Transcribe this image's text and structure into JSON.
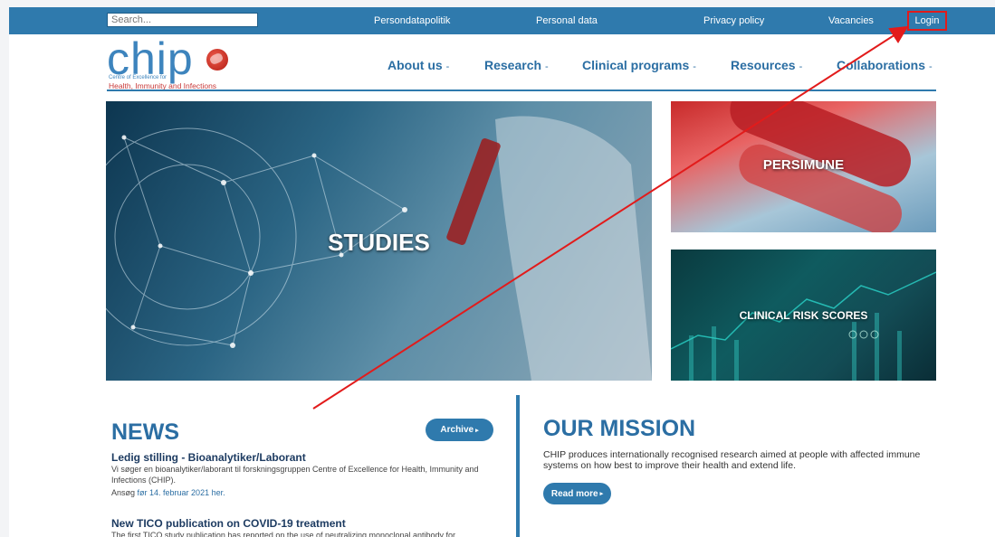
{
  "search": {
    "placeholder": "Search..."
  },
  "top_links": [
    {
      "label": "Persondatapolitik"
    },
    {
      "label": "Personal data"
    },
    {
      "label": "Privacy policy"
    },
    {
      "label": "Vacancies"
    },
    {
      "label": "Login"
    }
  ],
  "logo": {
    "word": "chip",
    "sub1": "Centre of Excellence for",
    "sub2": "Health, Immunity and Infections"
  },
  "nav": [
    {
      "label": "About us"
    },
    {
      "label": "Research"
    },
    {
      "label": "Clinical programs"
    },
    {
      "label": "Resources"
    },
    {
      "label": "Collaborations"
    }
  ],
  "nav_caret": "-",
  "tiles": {
    "studies": "STUDIES",
    "persimune": "PERSIMUNE",
    "clinical": "CLINICAL RISK SCORES"
  },
  "news": {
    "title": "NEWS",
    "archive_label": "Archive",
    "items": [
      {
        "heading": "Ledig stilling - Bioanalytiker/Laborant",
        "text1": "Vi søger en bioanalytiker/laborant til forskningsgruppen Centre of Excellence for Health, Immunity and Infections (CHIP).",
        "text2": "Ansøg",
        "text2_link": "før 14. februar 2021 her."
      },
      {
        "heading": "New TICO publication on COVID-19 treatment",
        "text1": "The first TICO study publication has reported on the use of neutralizing monoclonal antibody for"
      }
    ]
  },
  "mission": {
    "title": "OUR MISSION",
    "text": "CHIP produces internationally recognised research aimed at people with affected immune systems on how best to improve their health and extend life.",
    "read_more": "Read more"
  },
  "colors": {
    "brand_blue": "#2f7aad",
    "annotation_red": "#e21b1b"
  }
}
